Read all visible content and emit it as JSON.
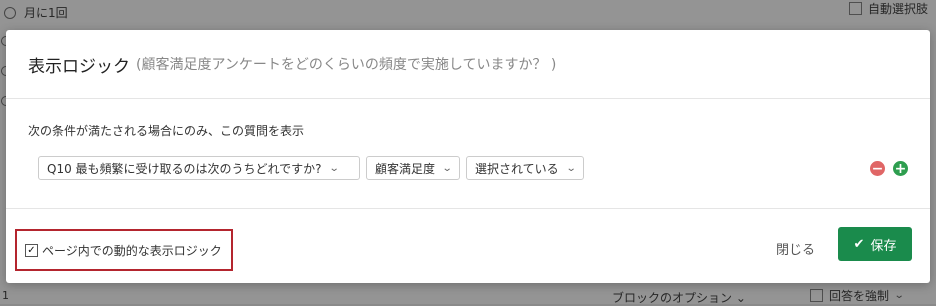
{
  "background": {
    "option_label": "月に1回",
    "auto_select_label": "自動選択肢",
    "row_number": "1",
    "block_options_label": "ブロックのオプション",
    "force_answer_label": "回答を強制"
  },
  "modal": {
    "title": "表示ロジック",
    "subtitle": "(顧客満足度アンケートをどのくらいの頻度で実施していますか？ )",
    "condition_description": "次の条件が満たされる場合にのみ、この質問を表示",
    "condition": {
      "question_select": "Q10 最も頻繁に受け取るのは次のうちどれですか?",
      "choice_select": "顧客満足度",
      "operator_select": "選択されている"
    },
    "dynamic_logic_label": "ページ内での動的な表示ロジック",
    "dynamic_logic_checked": true,
    "close_label": "閉じる",
    "save_label": "保存"
  },
  "colors": {
    "save_button": "#1a8b4c",
    "remove_icon": "#e06666",
    "add_icon": "#2e9e4f",
    "highlight_border": "#b4252e"
  },
  "icons": [
    "remove-condition-icon",
    "add-condition-icon",
    "checkmark-icon",
    "chevron-down-icon"
  ]
}
